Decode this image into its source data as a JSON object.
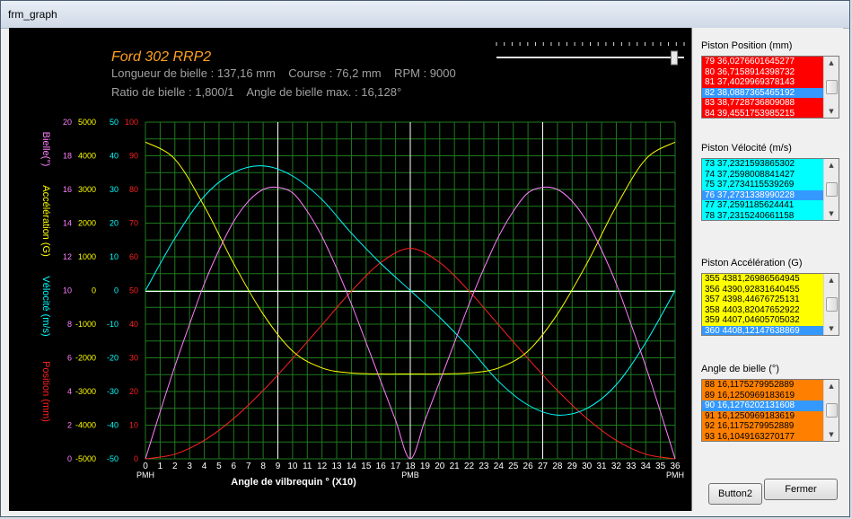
{
  "window": {
    "title": "frm_graph"
  },
  "graph": {
    "header_title": "Ford 302 RRP2",
    "info_line1": "Longueur de bielle : 137,16 mm    Course : 76,2 mm    RPM : 9000",
    "info_line2": "Ratio de bielle : 1,800/1    Angle de bielle max. : 16,128°",
    "slider_level": 0.95,
    "colors": {
      "position": "#ff2020",
      "velocite": "#00ffff",
      "acceleration": "#ffff00",
      "bielle": "#ff80ff",
      "grid": "#1e7a1e",
      "text": "#a0a0a0",
      "title": "#ffa020"
    }
  },
  "chart_data": {
    "type": "line",
    "x": {
      "label": "Angle de vilbrequin ° (X10)",
      "range": [
        0,
        36
      ],
      "ticks": [
        "0",
        "1",
        "2",
        "3",
        "4",
        "5",
        "6",
        "7",
        "8",
        "9",
        "10",
        "11",
        "12",
        "13",
        "14",
        "15",
        "16",
        "17",
        "18",
        "19",
        "20",
        "21",
        "22",
        "23",
        "24",
        "25",
        "26",
        "27",
        "28",
        "29",
        "30",
        "31",
        "32",
        "33",
        "34",
        "35",
        "36"
      ]
    },
    "x_markers": [
      {
        "x": 0,
        "label": "PMH"
      },
      {
        "x": 18,
        "label": "PMB"
      },
      {
        "x": 36,
        "label": "PMH"
      }
    ],
    "axes": [
      {
        "name": "Bielle(°)",
        "range": [
          0,
          20
        ],
        "ticks": [
          "0",
          "2",
          "4",
          "6",
          "8",
          "10",
          "12",
          "14",
          "16",
          "18",
          "20"
        ],
        "color": "#ff80ff"
      },
      {
        "name": "Accélération (G)",
        "range": [
          -5000,
          5000
        ],
        "ticks": [
          "-5000",
          "-4000",
          "-3000",
          "-2000",
          "-1000",
          "0",
          "1000",
          "2000",
          "3000",
          "4000",
          "5000"
        ],
        "color": "#ffff00"
      },
      {
        "name": "Vélocité (m/s)",
        "range": [
          -50,
          50
        ],
        "ticks": [
          "-50",
          "-40",
          "-30",
          "-20",
          "-10",
          "0",
          "10",
          "20",
          "30",
          "40",
          "50"
        ],
        "color": "#00ffff"
      },
      {
        "name": "Position (mm)",
        "range": [
          0,
          100
        ],
        "ticks": [
          "0",
          "10",
          "20",
          "30",
          "40",
          "50",
          "60",
          "70",
          "80",
          "90",
          "100"
        ],
        "color": "#ff2020"
      }
    ],
    "series": [
      {
        "name": "Position (mm)",
        "axis": 3,
        "color": "#ff2020",
        "x": [
          0,
          2,
          4,
          6,
          8,
          10,
          12,
          14,
          16,
          18,
          20,
          22,
          24,
          26,
          28,
          30,
          32,
          34,
          36
        ],
        "y": [
          0,
          1.4,
          5.5,
          12,
          20.3,
          29.8,
          39.8,
          49.8,
          58.3,
          62.5,
          58.3,
          49.8,
          39.8,
          29.8,
          20.3,
          12,
          5.5,
          1.4,
          0
        ]
      },
      {
        "name": "Vélocité (m/s)",
        "axis": 2,
        "color": "#00ffff",
        "x": [
          0,
          2,
          4,
          6,
          8,
          10,
          12,
          14,
          16,
          18,
          20,
          22,
          24,
          26,
          28,
          30,
          32,
          34,
          36
        ],
        "y": [
          0,
          15.5,
          28,
          35,
          37,
          34,
          27,
          17,
          8,
          0,
          -8,
          -17,
          -27,
          -34,
          -37,
          -35,
          -28,
          -15.5,
          0
        ]
      },
      {
        "name": "Accélération (G)",
        "axis": 1,
        "color": "#ffff00",
        "x": [
          0,
          2,
          4,
          6,
          8,
          10,
          12,
          14,
          16,
          18,
          20,
          22,
          24,
          26,
          28,
          30,
          32,
          34,
          36
        ],
        "y": [
          4408,
          3900,
          2500,
          800,
          -700,
          -1800,
          -2300,
          -2450,
          -2480,
          -2480,
          -2480,
          -2450,
          -2300,
          -1800,
          -700,
          800,
          2500,
          3900,
          4408
        ]
      },
      {
        "name": "Bielle(°)",
        "axis": 0,
        "color": "#ff80ff",
        "x": [
          0,
          1,
          2,
          3,
          4,
          5,
          6,
          7,
          8,
          9,
          10,
          11,
          12,
          13,
          14,
          15,
          16,
          17,
          18,
          19,
          20,
          21,
          22,
          23,
          24,
          25,
          26,
          27,
          28,
          29,
          30,
          31,
          32,
          33,
          34,
          35,
          36
        ],
        "y": [
          0,
          2.8,
          5.5,
          8,
          10.4,
          12.4,
          14.1,
          15.3,
          16,
          16.13,
          15.8,
          14.7,
          13.2,
          11.3,
          9.2,
          6.9,
          4.6,
          2.3,
          0,
          2.3,
          4.6,
          6.9,
          9.2,
          11.3,
          13.2,
          14.7,
          15.8,
          16.13,
          16,
          15.3,
          14.1,
          12.4,
          10.4,
          8,
          5.5,
          2.8,
          0
        ]
      }
    ]
  },
  "lists": [
    {
      "label": "Piston Position (mm)",
      "bg": "#ff0000",
      "fg": "#ffffff",
      "selected_index": 3,
      "items": [
        "79 36,0276601645277",
        "80 36,7158914398732",
        "81 37,4029969378143",
        "82 38,0887365465192",
        "83 38,7728736809088",
        "84 39,4551753985215"
      ]
    },
    {
      "label": "Piston Vélocité (m/s)",
      "bg": "#00ffff",
      "fg": "#000000",
      "selected_index": 3,
      "items": [
        "73 37,2321593865302",
        "74 37,2598008841427",
        "75 37,2734115539269",
        "76 37,2731338990228",
        "77 37,2591185624441",
        "78 37,2315240661158"
      ]
    },
    {
      "label": "Piston Accélération (G)",
      "bg": "#ffff00",
      "fg": "#000000",
      "selected_index": 5,
      "items": [
        "355 4381,26986564945",
        "356 4390,92831640455",
        "357 4398,44676725131",
        "358 4403,82047652922",
        "359 4407,04605705032",
        "360 4408,12147638869"
      ]
    },
    {
      "label": "Angle de bielle (°)",
      "bg": "#ff8000",
      "fg": "#000000",
      "selected_index": 2,
      "items": [
        "88 16,1175279952889",
        "89 16,1250969183619",
        "90 16,1276202131608",
        "91 16,1250969183619",
        "92 16,1175279952889",
        "93 16,1049163270177"
      ]
    }
  ],
  "buttons": {
    "button2": "Button2",
    "fermer": "Fermer"
  },
  "selection_color": "#3399ff"
}
